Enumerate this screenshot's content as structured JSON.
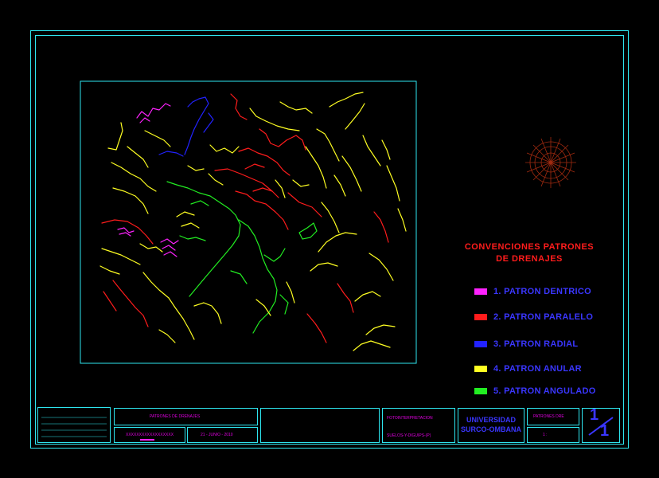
{
  "legend": {
    "title_line1": "CONVENCIONES PATRONES",
    "title_line2": "DE DRENAJES",
    "items": [
      {
        "label": "1. PATRON DENTRICO",
        "color": "#ff22ff"
      },
      {
        "label": "2. PATRON PARALELO",
        "color": "#ff1c1c"
      },
      {
        "label": "3. PATRON RADIAL",
        "color": "#2222ff"
      },
      {
        "label": "4. PATRON ANULAR",
        "color": "#ffff22"
      },
      {
        "label": "5. PATRON ANGULADO",
        "color": "#22ee22"
      }
    ]
  },
  "title_block": {
    "title": "PATRONES DE DRENAJES",
    "date": "21 - JUNIO - 2010",
    "subject_line1": "FOTOINTERPRETACION",
    "subject_line2": "SUELOS-Y-DIGUIPS-(P)",
    "university_line1": "UNIVERSIDAD",
    "university_line2": "SURCO-OMBANA",
    "scale": "1 :",
    "sheet_top": "1",
    "sheet_bottom": "1",
    "small_label": "PATRONES DRE",
    "small_magenta": "XXXXXXXXXXXXXXXXXX"
  },
  "colors": {
    "frame": "#2ee6f0",
    "dentrico": "#ff22ff",
    "paralelo": "#ff1c1c",
    "radial": "#2222ff",
    "anular": "#ffff22",
    "angulado": "#22ee22"
  }
}
